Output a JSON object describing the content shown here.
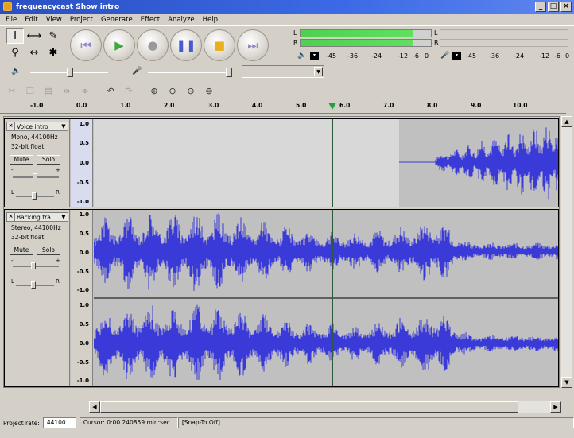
{
  "window": {
    "title": "frequencycast Show intro",
    "controls": [
      "_",
      "□",
      "×"
    ]
  },
  "menu": [
    "File",
    "Edit",
    "View",
    "Project",
    "Generate",
    "Effect",
    "Analyze",
    "Help"
  ],
  "tools": [
    {
      "name": "selection-tool",
      "glyph": "I",
      "selected": true
    },
    {
      "name": "envelope-tool",
      "glyph": "⟷",
      "selected": false
    },
    {
      "name": "draw-tool",
      "glyph": "✎",
      "selected": false
    },
    {
      "name": "zoom-tool",
      "glyph": "⚲",
      "selected": false
    },
    {
      "name": "timeshift-tool",
      "glyph": "↔",
      "selected": false
    },
    {
      "name": "multi-tool",
      "glyph": "✱",
      "selected": false
    }
  ],
  "transport": {
    "skip_start": "⏮",
    "play": "▶",
    "record": "●",
    "pause": "❚❚",
    "stop": "■",
    "skip_end": "⏭",
    "colors": {
      "play": "#3fa83f",
      "record": "#9a9a9a",
      "pause": "#4a5ad0",
      "stop": "#e8b020",
      "skip": "#9088c8"
    }
  },
  "meters": {
    "output_channels": [
      "L",
      "R"
    ],
    "output_levels": [
      0.86,
      0.86
    ],
    "input_channels": [
      "L",
      "R"
    ],
    "scale": [
      "-45",
      "-36",
      "-24",
      "-12",
      "-6",
      "0"
    ],
    "input_scale": [
      "-45",
      "-36",
      "-24",
      "-12",
      "-6",
      "0"
    ]
  },
  "ruler": {
    "labels": [
      "-1.0",
      "0.0",
      "1.0",
      "2.0",
      "3.0",
      "4.0",
      "5.0",
      "6.0",
      "7.0",
      "8.0",
      "9.0",
      "10.0"
    ]
  },
  "tracks": [
    {
      "name": "Voice intro",
      "info1": "Mono, 44100Hz",
      "info2": "32-bit float",
      "mute": "Mute",
      "solo": "Solo",
      "gain_minus": "-",
      "gain_plus": "+",
      "pan_left": "L",
      "pan_right": "R",
      "scale": [
        "1.0",
        "0.5",
        "0.0",
        "-0.5",
        "-1.0"
      ]
    },
    {
      "name": "Backing tra",
      "info1": "Stereo, 44100Hz",
      "info2": "32-bit float",
      "mute": "Mute",
      "solo": "Solo",
      "gain_minus": "-",
      "gain_plus": "+",
      "pan_left": "L",
      "pan_right": "R",
      "scale": [
        "1.0",
        "0.5",
        "0.0",
        "-0.5",
        "-1.0"
      ],
      "scale2": [
        "1.0",
        "0.5",
        "0.0",
        "-0.5",
        "-1.0"
      ]
    }
  ],
  "status": {
    "rate_label": "Project rate:",
    "rate_value": "44100",
    "cursor": "Cursor: 0:00.240859 min:sec",
    "snap": "[Snap-To Off]"
  },
  "colors": {
    "waveform": "#3a3ad8",
    "track_bg": "#c0c0c0",
    "selection_bg": "#d8d8d8"
  }
}
